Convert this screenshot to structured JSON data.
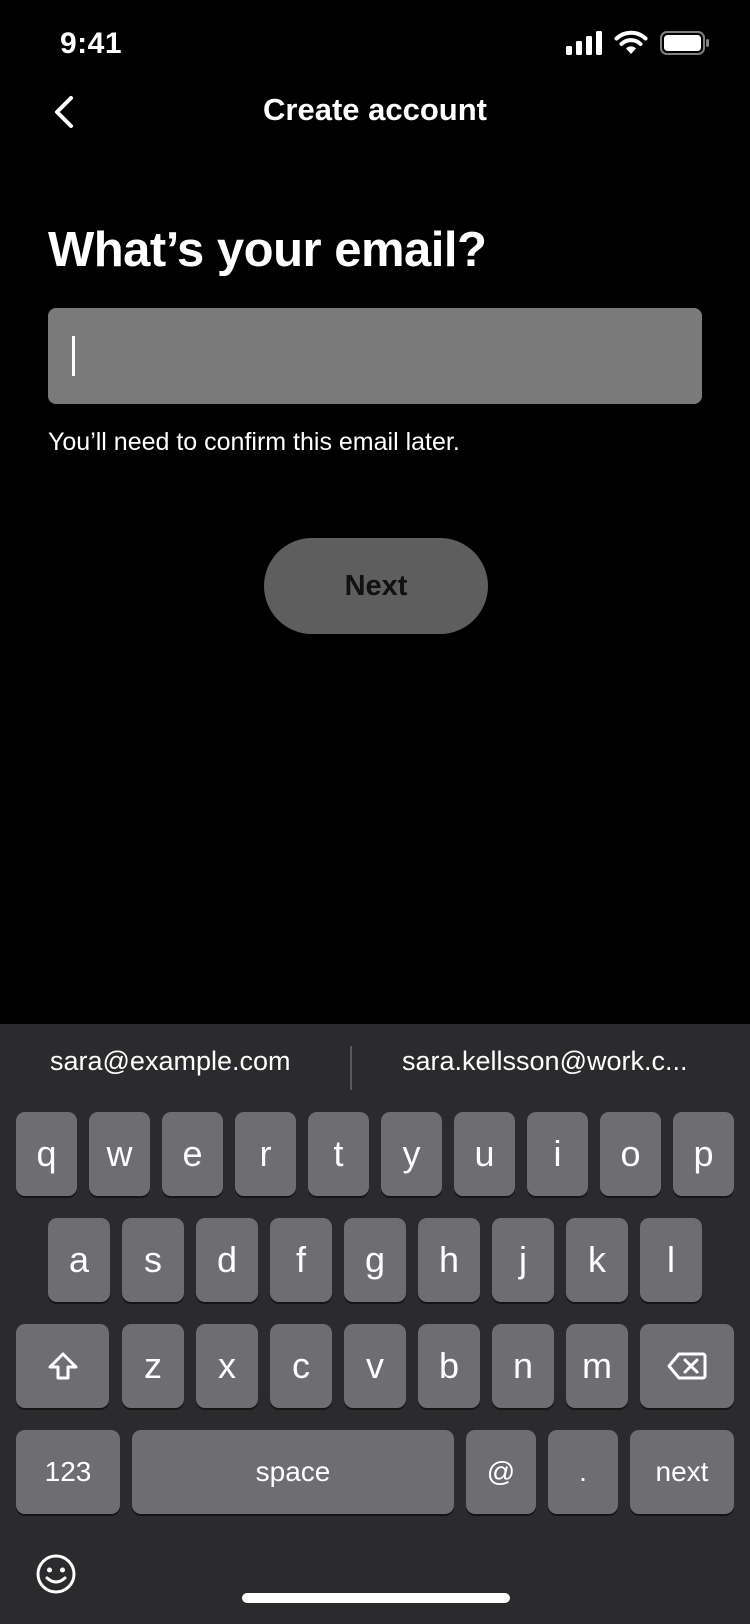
{
  "status_bar": {
    "time": "9:41",
    "icons": [
      "signal-icon",
      "wifi-icon",
      "battery-icon"
    ]
  },
  "nav": {
    "title": "Create account",
    "back_icon": "chevron-left-icon"
  },
  "form": {
    "heading": "What’s your email?",
    "email_value": "",
    "helper": "You’ll need to confirm this email later.",
    "next_label": "Next"
  },
  "keyboard": {
    "suggestions": [
      "sara@example.com",
      "sara.kellsson@work.c..."
    ],
    "row1": [
      "q",
      "w",
      "e",
      "r",
      "t",
      "y",
      "u",
      "i",
      "o",
      "p"
    ],
    "row2": [
      "a",
      "s",
      "d",
      "f",
      "g",
      "h",
      "j",
      "k",
      "l"
    ],
    "row3": [
      "z",
      "x",
      "c",
      "v",
      "b",
      "n",
      "m"
    ],
    "bottom": {
      "numbers": "123",
      "space": "space",
      "at": "@",
      "dot": ".",
      "return": "next"
    },
    "shift_icon": "shift-icon",
    "delete_icon": "backspace-icon",
    "emoji_icon": "emoji-icon"
  },
  "colors": {
    "background": "#000000",
    "input_bg": "#7a7a7a",
    "button_bg": "#5e5e5e",
    "keyboard_bg": "#2b2b2d",
    "key_bg": "#6e6e72"
  }
}
